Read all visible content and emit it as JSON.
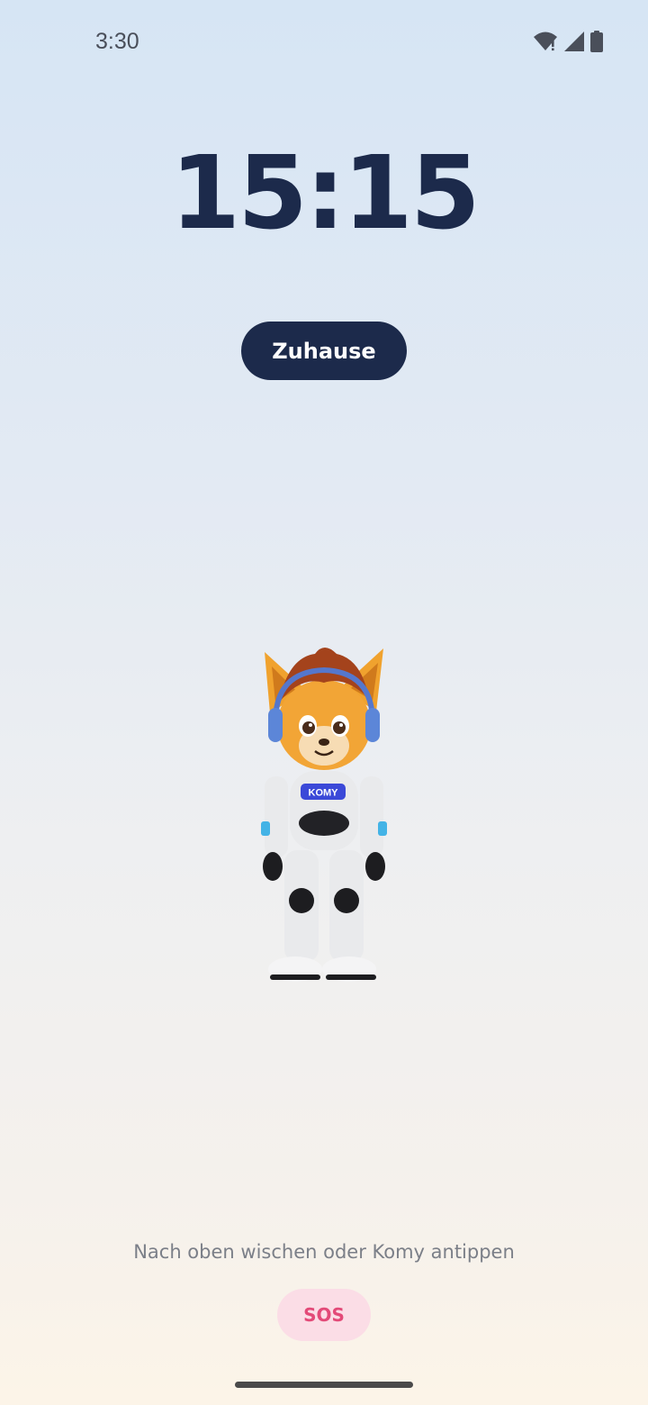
{
  "status_bar": {
    "time": "3:30",
    "icons": [
      "wifi-icon",
      "cell-signal-icon",
      "battery-icon"
    ]
  },
  "lock_screen": {
    "clock": "15:15",
    "location_label": "Zuhause",
    "mascot_badge": "KOMY",
    "hint": "Nach oben wischen oder Komy antippen",
    "sos_label": "SOS"
  },
  "colors": {
    "navy": "#1c2a4b",
    "sos_text": "#e34a78",
    "sos_bg": "#fbdde6",
    "background_top": "#d6e5f4",
    "background_bottom": "#fcf4e8"
  }
}
